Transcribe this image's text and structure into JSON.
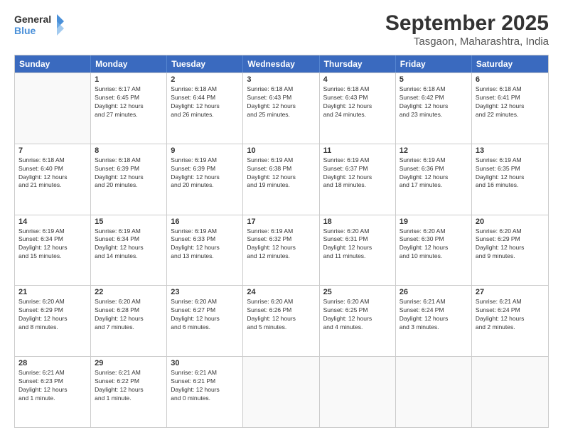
{
  "header": {
    "logo_line1": "General",
    "logo_line2": "Blue",
    "main_title": "September 2025",
    "sub_title": "Tasgaon, Maharashtra, India"
  },
  "days_of_week": [
    "Sunday",
    "Monday",
    "Tuesday",
    "Wednesday",
    "Thursday",
    "Friday",
    "Saturday"
  ],
  "weeks": [
    [
      {
        "day": "",
        "info": ""
      },
      {
        "day": "1",
        "info": "Sunrise: 6:17 AM\nSunset: 6:45 PM\nDaylight: 12 hours\nand 27 minutes."
      },
      {
        "day": "2",
        "info": "Sunrise: 6:18 AM\nSunset: 6:44 PM\nDaylight: 12 hours\nand 26 minutes."
      },
      {
        "day": "3",
        "info": "Sunrise: 6:18 AM\nSunset: 6:43 PM\nDaylight: 12 hours\nand 25 minutes."
      },
      {
        "day": "4",
        "info": "Sunrise: 6:18 AM\nSunset: 6:43 PM\nDaylight: 12 hours\nand 24 minutes."
      },
      {
        "day": "5",
        "info": "Sunrise: 6:18 AM\nSunset: 6:42 PM\nDaylight: 12 hours\nand 23 minutes."
      },
      {
        "day": "6",
        "info": "Sunrise: 6:18 AM\nSunset: 6:41 PM\nDaylight: 12 hours\nand 22 minutes."
      }
    ],
    [
      {
        "day": "7",
        "info": "Sunrise: 6:18 AM\nSunset: 6:40 PM\nDaylight: 12 hours\nand 21 minutes."
      },
      {
        "day": "8",
        "info": "Sunrise: 6:18 AM\nSunset: 6:39 PM\nDaylight: 12 hours\nand 20 minutes."
      },
      {
        "day": "9",
        "info": "Sunrise: 6:19 AM\nSunset: 6:39 PM\nDaylight: 12 hours\nand 20 minutes."
      },
      {
        "day": "10",
        "info": "Sunrise: 6:19 AM\nSunset: 6:38 PM\nDaylight: 12 hours\nand 19 minutes."
      },
      {
        "day": "11",
        "info": "Sunrise: 6:19 AM\nSunset: 6:37 PM\nDaylight: 12 hours\nand 18 minutes."
      },
      {
        "day": "12",
        "info": "Sunrise: 6:19 AM\nSunset: 6:36 PM\nDaylight: 12 hours\nand 17 minutes."
      },
      {
        "day": "13",
        "info": "Sunrise: 6:19 AM\nSunset: 6:35 PM\nDaylight: 12 hours\nand 16 minutes."
      }
    ],
    [
      {
        "day": "14",
        "info": "Sunrise: 6:19 AM\nSunset: 6:34 PM\nDaylight: 12 hours\nand 15 minutes."
      },
      {
        "day": "15",
        "info": "Sunrise: 6:19 AM\nSunset: 6:34 PM\nDaylight: 12 hours\nand 14 minutes."
      },
      {
        "day": "16",
        "info": "Sunrise: 6:19 AM\nSunset: 6:33 PM\nDaylight: 12 hours\nand 13 minutes."
      },
      {
        "day": "17",
        "info": "Sunrise: 6:19 AM\nSunset: 6:32 PM\nDaylight: 12 hours\nand 12 minutes."
      },
      {
        "day": "18",
        "info": "Sunrise: 6:20 AM\nSunset: 6:31 PM\nDaylight: 12 hours\nand 11 minutes."
      },
      {
        "day": "19",
        "info": "Sunrise: 6:20 AM\nSunset: 6:30 PM\nDaylight: 12 hours\nand 10 minutes."
      },
      {
        "day": "20",
        "info": "Sunrise: 6:20 AM\nSunset: 6:29 PM\nDaylight: 12 hours\nand 9 minutes."
      }
    ],
    [
      {
        "day": "21",
        "info": "Sunrise: 6:20 AM\nSunset: 6:29 PM\nDaylight: 12 hours\nand 8 minutes."
      },
      {
        "day": "22",
        "info": "Sunrise: 6:20 AM\nSunset: 6:28 PM\nDaylight: 12 hours\nand 7 minutes."
      },
      {
        "day": "23",
        "info": "Sunrise: 6:20 AM\nSunset: 6:27 PM\nDaylight: 12 hours\nand 6 minutes."
      },
      {
        "day": "24",
        "info": "Sunrise: 6:20 AM\nSunset: 6:26 PM\nDaylight: 12 hours\nand 5 minutes."
      },
      {
        "day": "25",
        "info": "Sunrise: 6:20 AM\nSunset: 6:25 PM\nDaylight: 12 hours\nand 4 minutes."
      },
      {
        "day": "26",
        "info": "Sunrise: 6:21 AM\nSunset: 6:24 PM\nDaylight: 12 hours\nand 3 minutes."
      },
      {
        "day": "27",
        "info": "Sunrise: 6:21 AM\nSunset: 6:24 PM\nDaylight: 12 hours\nand 2 minutes."
      }
    ],
    [
      {
        "day": "28",
        "info": "Sunrise: 6:21 AM\nSunset: 6:23 PM\nDaylight: 12 hours\nand 1 minute."
      },
      {
        "day": "29",
        "info": "Sunrise: 6:21 AM\nSunset: 6:22 PM\nDaylight: 12 hours\nand 1 minute."
      },
      {
        "day": "30",
        "info": "Sunrise: 6:21 AM\nSunset: 6:21 PM\nDaylight: 12 hours\nand 0 minutes."
      },
      {
        "day": "",
        "info": ""
      },
      {
        "day": "",
        "info": ""
      },
      {
        "day": "",
        "info": ""
      },
      {
        "day": "",
        "info": ""
      }
    ]
  ]
}
